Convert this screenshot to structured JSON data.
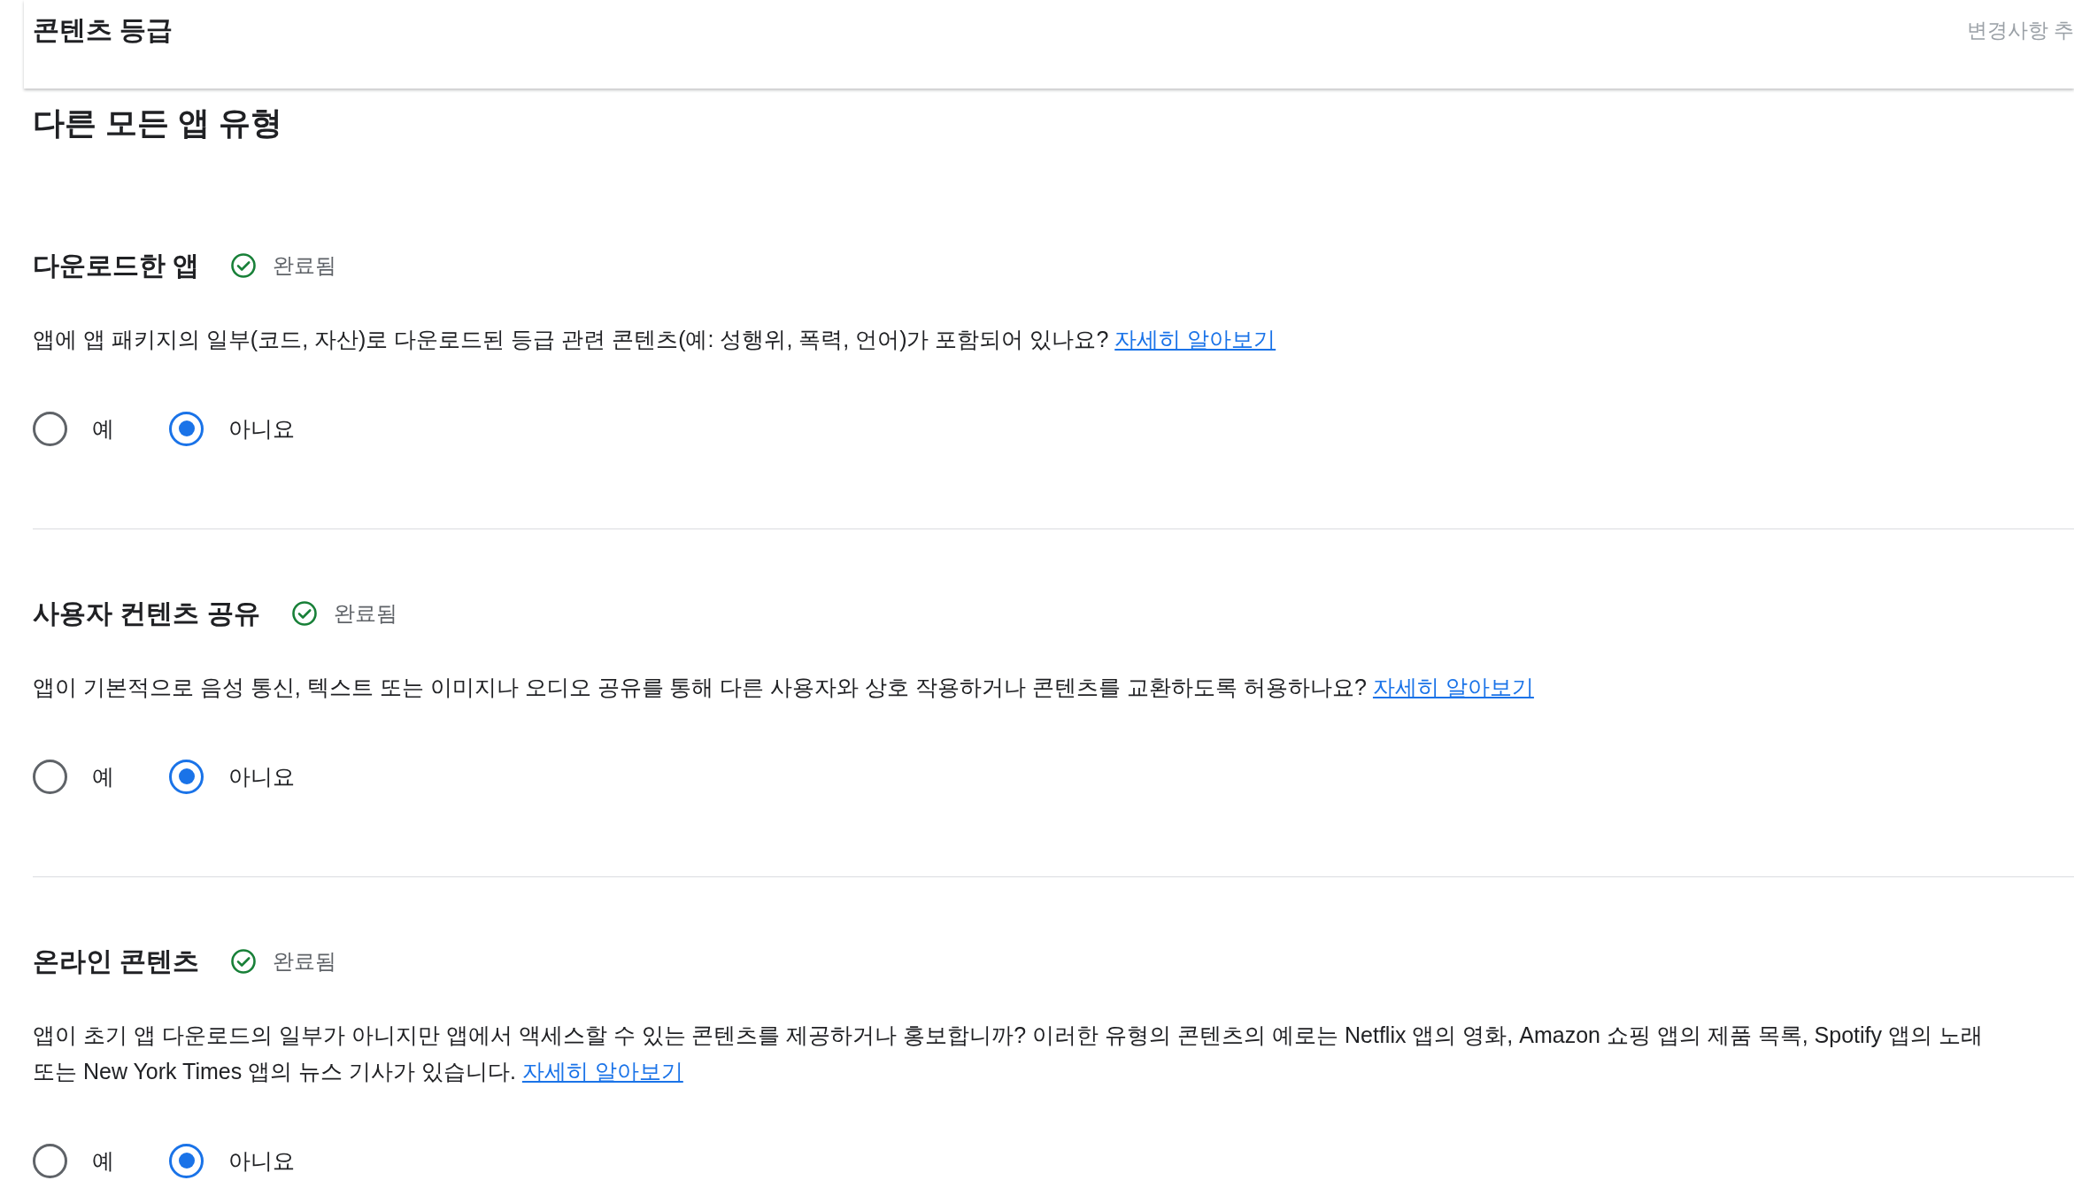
{
  "header": {
    "title": "콘텐츠 등급",
    "side_text": "변경사항 추"
  },
  "page_title": "다른 모든 앱 유형",
  "sections": [
    {
      "title": "다운로드한 앱",
      "status": "완료됨",
      "question": "앱에 앱 패키지의 일부(코드, 자산)로 다운로드된 등급 관련 콘텐츠(예: 성행위, 폭력, 언어)가 포함되어 있나요?",
      "link": "자세히 알아보기",
      "options": [
        {
          "label": "예",
          "selected": false
        },
        {
          "label": "아니요",
          "selected": true
        }
      ]
    },
    {
      "title": "사용자 컨텐츠 공유",
      "status": "완료됨",
      "question": "앱이 기본적으로 음성 통신, 텍스트 또는 이미지나 오디오 공유를 통해 다른 사용자와 상호 작용하거나 콘텐츠를 교환하도록 허용하나요?",
      "link": "자세히 알아보기",
      "options": [
        {
          "label": "예",
          "selected": false
        },
        {
          "label": "아니요",
          "selected": true
        }
      ]
    },
    {
      "title": "온라인 콘텐츠",
      "status": "완료됨",
      "question": "앱이 초기 앱 다운로드의 일부가 아니지만 앱에서 액세스할 수 있는 콘텐츠를 제공하거나 홍보합니까? 이러한 유형의 콘텐츠의 예로는 Netflix 앱의 영화, Amazon 쇼핑 앱의 제품 목록, Spotify 앱의 노래 또는 New York Times 앱의 뉴스 기사가 있습니다.",
      "link": "자세히 알아보기",
      "options": [
        {
          "label": "예",
          "selected": false
        },
        {
          "label": "아니요",
          "selected": true
        }
      ]
    }
  ]
}
